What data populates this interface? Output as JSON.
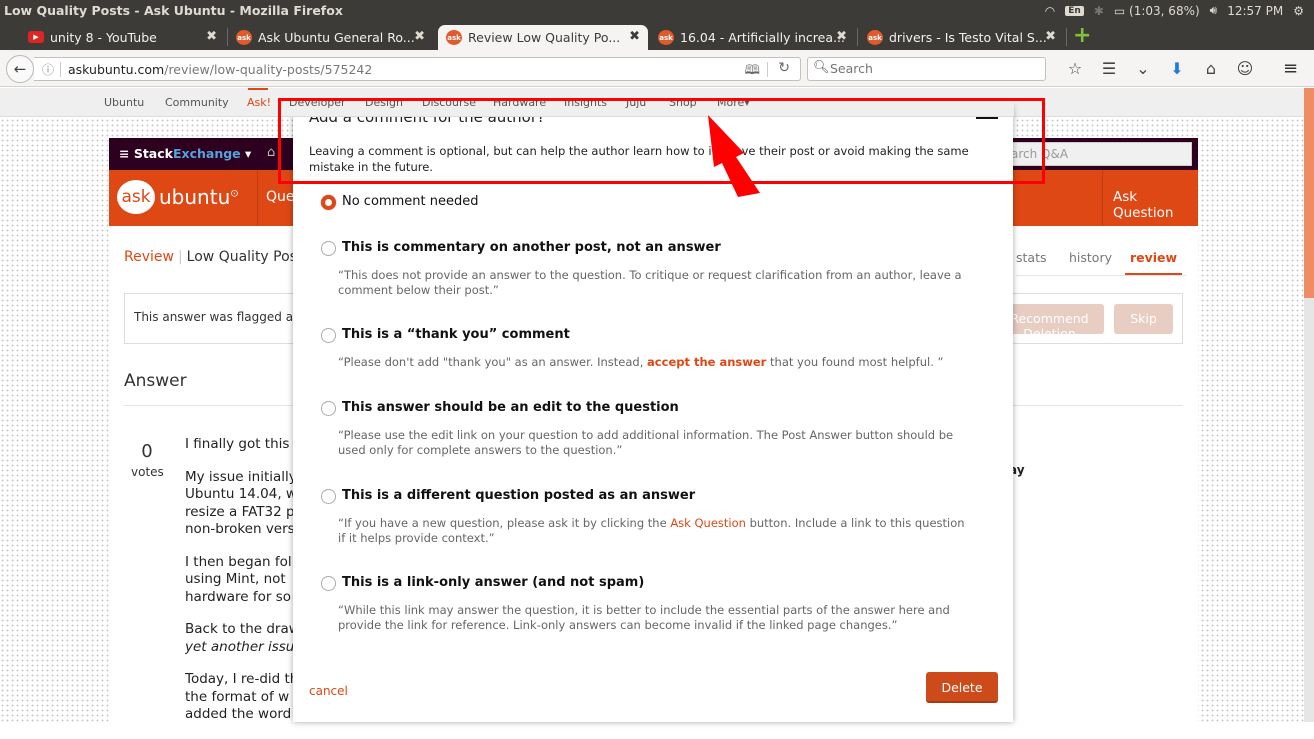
{
  "os": {
    "window_title": "Low Quality Posts - Ask Ubuntu - Mozilla Firefox",
    "input_lang": "En",
    "battery": "(1:03, 68%)",
    "clock": "12:57 PM"
  },
  "tabs": [
    {
      "title": "unity 8 - YouTube",
      "icon": "youtube-icon",
      "active": false
    },
    {
      "title": "Ask Ubuntu General Ro...",
      "icon": "askubuntu-icon",
      "active": false
    },
    {
      "title": "Review Low Quality Po...",
      "icon": "askubuntu-icon",
      "active": true
    },
    {
      "title": "16.04 - Artificially increa...",
      "icon": "askubuntu-icon",
      "active": false
    },
    {
      "title": "drivers - Is Testo Vital S...",
      "icon": "askubuntu-icon",
      "active": false
    }
  ],
  "tab_icon_text": "ask",
  "navbar": {
    "url_domain": "askubuntu.com",
    "url_path": "/review/low-quality-posts/575242",
    "search_placeholder": "Search"
  },
  "ubuntu_nav": {
    "items": [
      "Ubuntu",
      "Community",
      "Ask!",
      "Developer",
      "Design",
      "Discourse",
      "Hardware",
      "Insights",
      "Juju",
      "Shop",
      "More"
    ],
    "active": "Ask!"
  },
  "site": {
    "stack": "Stack",
    "exchange": "Exchange",
    "search_placeholder": "Search Q&A",
    "logo_ask": "ask",
    "logo_word": "ubuntu",
    "questions_link": "Questions",
    "ask_question": "Ask Question",
    "breadcrumb_review": "Review",
    "breadcrumb_queue": "Low Quality Posts",
    "review_tabs": [
      "stats",
      "history",
      "review"
    ],
    "flag_text": "This answer was flagged as",
    "recommend_deletion": "Recommend Deletion",
    "skip": "Skip",
    "answer_heading": "Answer",
    "votes_count": "0",
    "votes_label": "votes",
    "post_lines": [
      "I finally got this",
      "My issue initially",
      "Ubuntu 14.04, w",
      "resize a FAT32 p",
      "non-broken vers",
      "I then began fol",
      "using Mint, not",
      "hardware for so",
      "Back to the draw",
      "yet another issu",
      "Today, I re-did th",
      "the format of w",
      "added the word"
    ],
    "side_fragment": "ay"
  },
  "modal": {
    "title": "Add a comment for the author?",
    "description": "Leaving a comment is optional, but can help the author learn how to improve their post or avoid making the same mistake in the future.",
    "options": [
      {
        "label": "No comment needed",
        "checked": true,
        "bold": false,
        "desc": ""
      },
      {
        "label": "This is commentary on another post, not an answer",
        "checked": false,
        "bold": true,
        "desc": "“This does not provide an answer to the question. To critique or request clarification from an author, leave a comment below their post.”"
      },
      {
        "label": "This is a “thank you” comment",
        "checked": false,
        "bold": true,
        "desc_before": "“Please don't add \"thank you\" as an answer. Instead, ",
        "desc_link": "accept the answer",
        "desc_after": " that you found most helpful. ”"
      },
      {
        "label": "This answer should be an edit to the question",
        "checked": false,
        "bold": true,
        "desc": "“Please use the edit link on your question to add additional information. The Post Answer button should be used only for complete answers to the question.”"
      },
      {
        "label": "This is a different question posted as an answer",
        "checked": false,
        "bold": true,
        "desc_before": "“If you have a new question, please ask it by clicking the ",
        "desc_link": "Ask Question",
        "desc_after": " button. Include a link to this question if it helps provide context.”"
      },
      {
        "label": "This is a link-only answer (and not spam)",
        "checked": false,
        "bold": true,
        "desc": "“While this link may answer the question, it is better to include the essential parts of the answer here and provide the link for reference. Link-only answers can become invalid if the linked page changes.”"
      }
    ],
    "cancel": "cancel",
    "delete": "Delete"
  },
  "colors": {
    "accent": "#dd4814",
    "annotation": "#ff0000",
    "se_bar": "#2c001e"
  }
}
